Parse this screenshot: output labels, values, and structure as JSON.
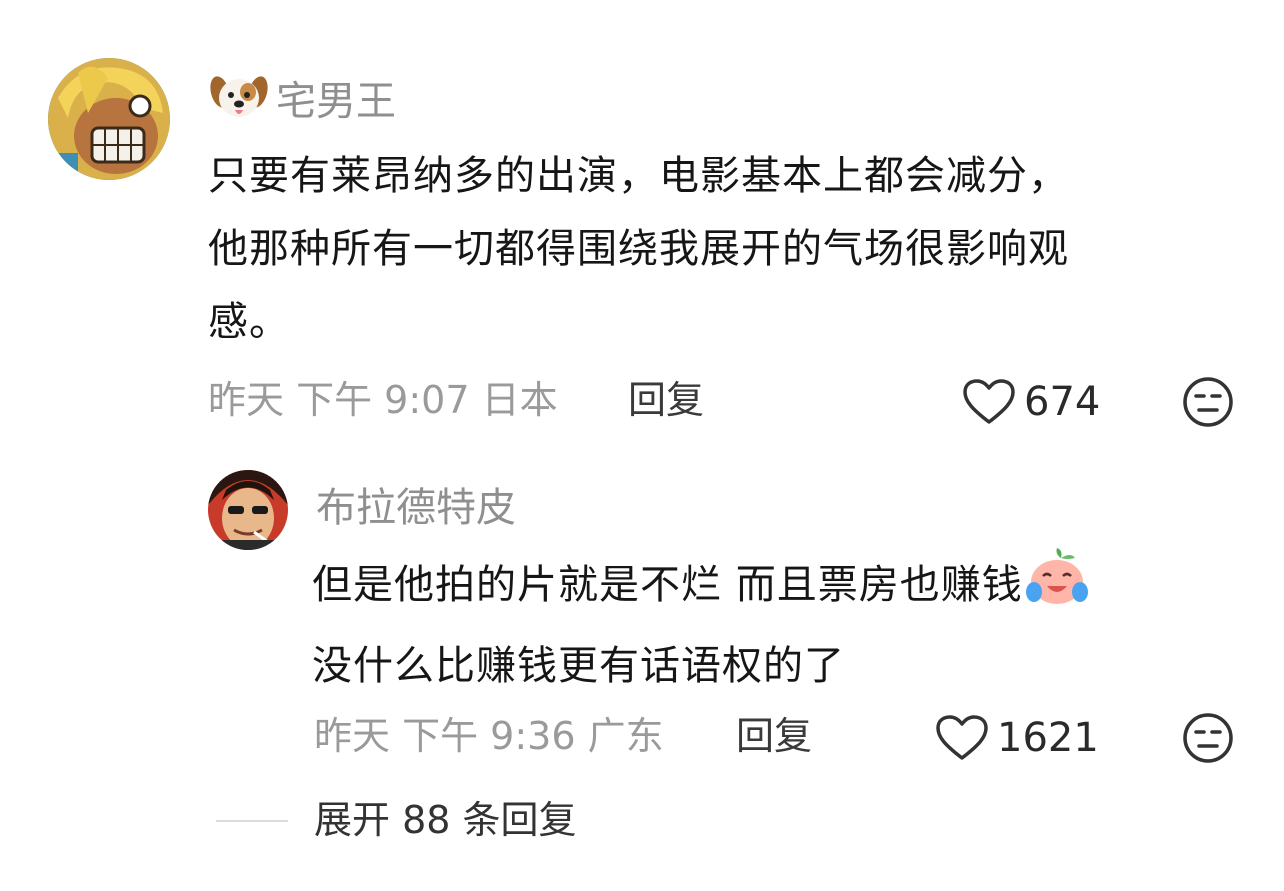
{
  "comments": [
    {
      "username": "宅男王",
      "badge_icon": "dog-face-emoji-icon",
      "content_lines": [
        "只要有莱昂纳多的出演，电影基本上都会减分，",
        "他那种所有一切都得围绕我展开的气场很影响观",
        "感。"
      ],
      "meta": "昨天 下午 9:07 日本",
      "reply_label": "回复",
      "likes": "674"
    },
    {
      "username": "布拉德特皮",
      "content_lines": [
        "但是他拍的片就是不烂  而且票房也赚钱",
        "没什么比赚钱更有话语权的了"
      ],
      "content_emoji": "crying-laughing-peach-emoji-icon",
      "meta": "昨天 下午 9:36 广东",
      "reply_label": "回复",
      "likes": "1621"
    }
  ],
  "expand_replies_label": "展开 88 条回复",
  "colors": {
    "meta_gray": "#9a9a9a",
    "username_gray": "#8f8f8f",
    "text": "#161616"
  }
}
